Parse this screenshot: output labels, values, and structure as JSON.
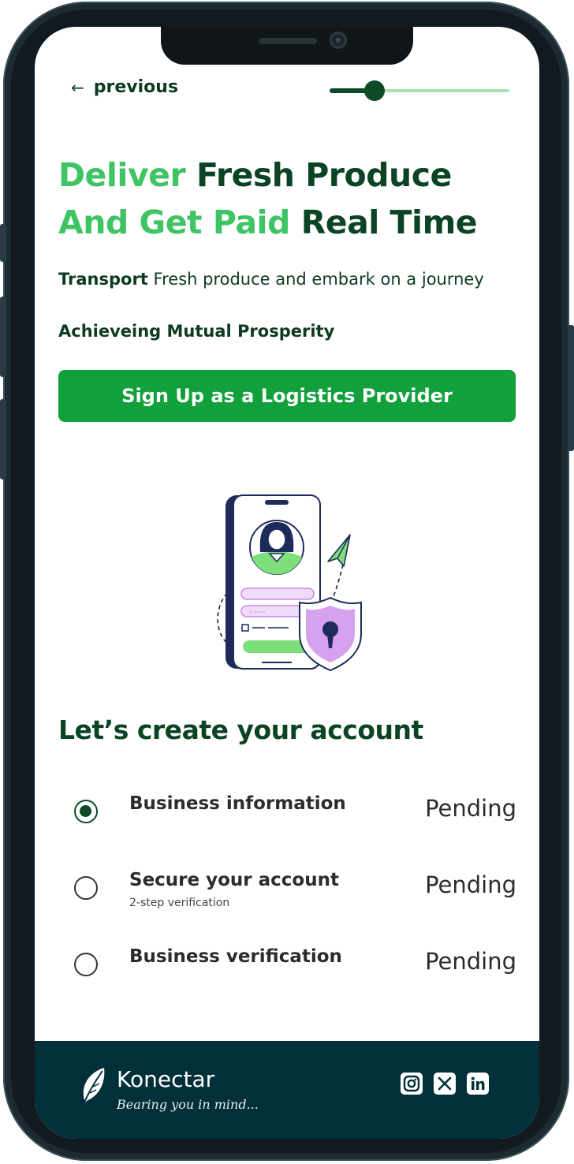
{
  "nav": {
    "back_label": "previous",
    "progress_fraction": 0.25
  },
  "hero": {
    "line1_accent": "Deliver",
    "line1_rest": "Fresh Produce",
    "line2_accent": "And Get Paid",
    "line2_rest": "Real Time",
    "desc_bold": "Transport",
    "desc_rest": "Fresh produce and embark on a journey",
    "desc_tagline": "Achieveing Mutual Prosperity",
    "cta_label": "Sign Up as a Logistics Provider"
  },
  "account": {
    "title": "Let’s create your account",
    "steps": [
      {
        "label": "Business information",
        "sublabel": "",
        "status": "Pending",
        "selected": true
      },
      {
        "label": "Secure your account",
        "sublabel": "2-step verification",
        "status": "Pending",
        "selected": false
      },
      {
        "label": "Business verification",
        "sublabel": "",
        "status": "Pending",
        "selected": false
      }
    ]
  },
  "footer": {
    "brand_name": "Konectar",
    "tagline": "Bearing you in mind...",
    "social_icons": [
      "instagram-icon",
      "x-icon",
      "linkedin-icon"
    ]
  },
  "colors": {
    "accent_green": "#3ec462",
    "dark_green": "#0b4424",
    "button_green": "#11a03c",
    "footer_bg": "#02303a"
  }
}
